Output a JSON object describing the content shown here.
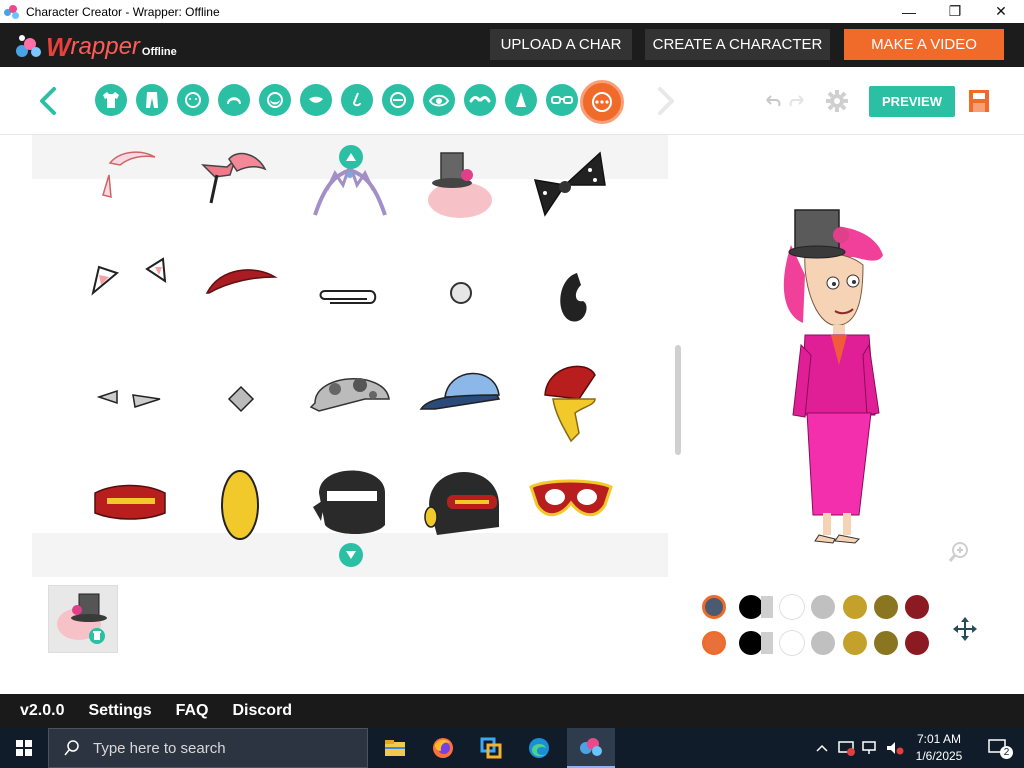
{
  "window": {
    "title": "Character Creator - Wrapper: Offline",
    "minimize_glyph": "—",
    "maximize_glyph": "❐",
    "close_glyph": "✕"
  },
  "header": {
    "logo_w": "W",
    "logo_rapper": "rapper",
    "logo_sub": "Offline",
    "upload_label": "UPLOAD A CHAR",
    "create_label": "CREATE A CHARACTER",
    "make_video_label": "MAKE A VIDEO"
  },
  "toolbar": {
    "categories": [
      {
        "icon": "shirt-icon"
      },
      {
        "icon": "pants-icon"
      },
      {
        "icon": "face-shape-icon"
      },
      {
        "icon": "hair-icon"
      },
      {
        "icon": "beard-icon"
      },
      {
        "icon": "mouth-icon"
      },
      {
        "icon": "nose-icon"
      },
      {
        "icon": "eyelid-icon"
      },
      {
        "icon": "eye-icon"
      },
      {
        "icon": "eyebrow-icon"
      },
      {
        "icon": "ear-icon"
      },
      {
        "icon": "glasses-icon"
      },
      {
        "icon": "accessory-icon",
        "active": true
      }
    ],
    "preview_label": "PREVIEW"
  },
  "colors": {
    "teal": "#2bbfa4",
    "orange": "#f06a2a",
    "dark": "#1c1c1c",
    "row1": [
      "#4a5a70",
      "#000000",
      "#ffffff",
      "#c0c0c0",
      "#c4a12a",
      "#8a7520",
      "#8b1a22"
    ],
    "row2": [
      "#e8703a",
      "#000000",
      "#ffffff",
      "#c0c0c0",
      "#c4a12a",
      "#8a7520",
      "#8b1a22"
    ]
  },
  "footer": {
    "version": "v2.0.0",
    "settings": "Settings",
    "faq": "FAQ",
    "discord": "Discord"
  },
  "taskbar": {
    "search_placeholder": "Type here to search",
    "time": "7:01 AM",
    "date": "1/6/2025",
    "notification_count": "2"
  }
}
